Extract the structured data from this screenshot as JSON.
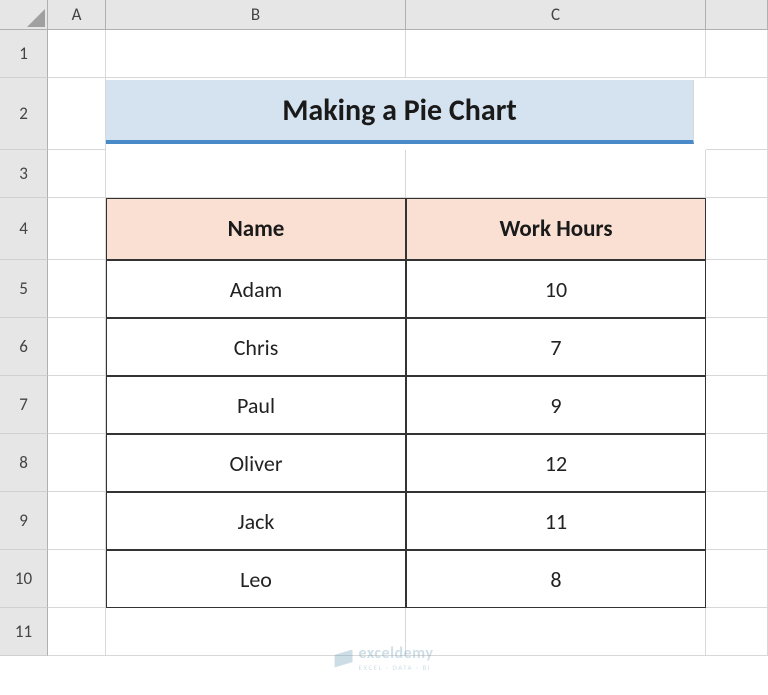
{
  "columns": [
    "A",
    "B",
    "C"
  ],
  "rows": [
    "1",
    "2",
    "3",
    "4",
    "5",
    "6",
    "7",
    "8",
    "9",
    "10",
    "11"
  ],
  "title": "Making a Pie Chart",
  "table": {
    "headers": {
      "name": "Name",
      "hours": "Work Hours"
    },
    "data": [
      {
        "name": "Adam",
        "hours": "10"
      },
      {
        "name": "Chris",
        "hours": "7"
      },
      {
        "name": "Paul",
        "hours": "9"
      },
      {
        "name": "Oliver",
        "hours": "12"
      },
      {
        "name": "Jack",
        "hours": "11"
      },
      {
        "name": "Leo",
        "hours": "8"
      }
    ]
  },
  "watermark": {
    "main": "exceldemy",
    "sub": "EXCEL · DATA · BI"
  },
  "chart_data": {
    "type": "table",
    "title": "Making a Pie Chart",
    "categories": [
      "Adam",
      "Chris",
      "Paul",
      "Oliver",
      "Jack",
      "Leo"
    ],
    "values": [
      10,
      7,
      9,
      12,
      11,
      8
    ],
    "xlabel": "Name",
    "ylabel": "Work Hours"
  }
}
